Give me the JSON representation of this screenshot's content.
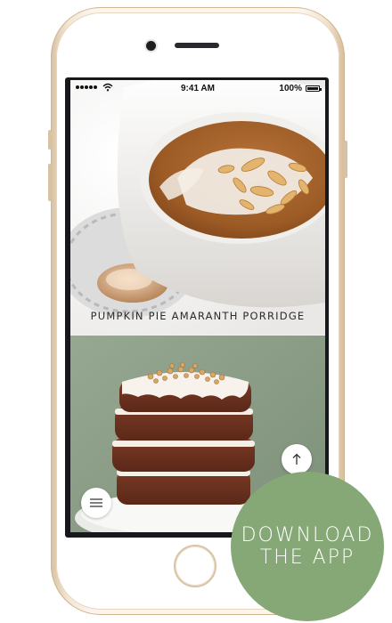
{
  "status_bar": {
    "time": "9:41 AM",
    "battery": "100%",
    "battery_level": 1.0
  },
  "recipes": [
    {
      "title": "PUMPKIN PIE AMARANTH PORRIDGE"
    }
  ],
  "badge": {
    "line1": "DOWNLOAD",
    "line2": "THE APP",
    "color": "#85a876"
  },
  "icons": {
    "scroll_up": "arrow-up-icon",
    "menu": "hamburger-menu-icon",
    "signal": "signal-dots-icon",
    "wifi": "wifi-icon",
    "battery": "battery-icon"
  }
}
